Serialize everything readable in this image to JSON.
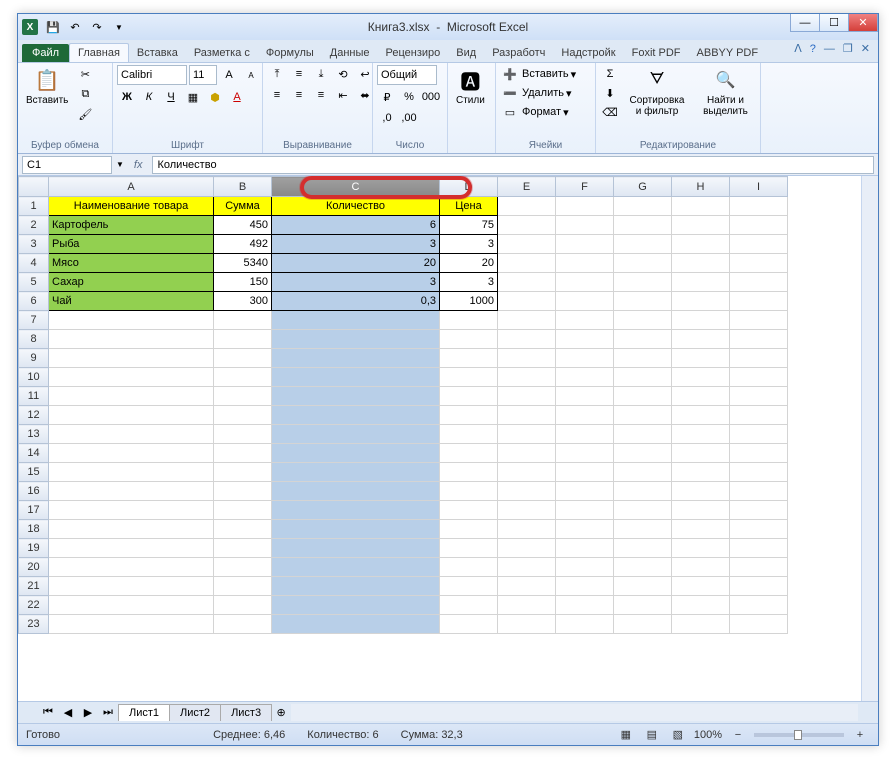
{
  "window": {
    "title_doc": "Книга3.xlsx",
    "title_app": "Microsoft Excel"
  },
  "ribbon": {
    "file": "Файл",
    "tabs": [
      "Главная",
      "Вставка",
      "Разметка с",
      "Формулы",
      "Данные",
      "Рецензиро",
      "Вид",
      "Разработч",
      "Надстройк",
      "Foxit PDF",
      "ABBYY PDF"
    ],
    "groups": {
      "clipboard": {
        "label": "Буфер обмена",
        "paste": "Вставить"
      },
      "font": {
        "label": "Шрифт",
        "name": "Calibri",
        "size": "11"
      },
      "align": {
        "label": "Выравнивание"
      },
      "number": {
        "label": "Число",
        "format": "Общий"
      },
      "styles": {
        "label": "",
        "btn": "Стили"
      },
      "cells": {
        "label": "Ячейки",
        "insert": "Вставить",
        "delete": "Удалить",
        "format": "Формат"
      },
      "editing": {
        "label": "Редактирование",
        "sort": "Сортировка и фильтр",
        "find": "Найти и выделить"
      }
    }
  },
  "formula": {
    "namebox": "C1",
    "value": "Количество"
  },
  "columns": [
    "A",
    "B",
    "C",
    "D",
    "E",
    "F",
    "G",
    "H",
    "I"
  ],
  "sheet_data": {
    "headers": {
      "A": "Наименование товара",
      "B": "Сумма",
      "C": "Количество",
      "D": "Цена"
    },
    "rows": [
      {
        "A": "Картофель",
        "B": "450",
        "C": "6",
        "D": "75"
      },
      {
        "A": "Рыба",
        "B": "492",
        "C": "3",
        "D": "3"
      },
      {
        "A": "Мясо",
        "B": "5340",
        "C": "20",
        "D": "20"
      },
      {
        "A": "Сахар",
        "B": "150",
        "C": "3",
        "D": "3"
      },
      {
        "A": "Чай",
        "B": "300",
        "C": "0,3",
        "D": "1000"
      }
    ]
  },
  "sheets": [
    "Лист1",
    "Лист2",
    "Лист3"
  ],
  "status": {
    "ready": "Готово",
    "avg_lbl": "Среднее:",
    "avg": "6,46",
    "cnt_lbl": "Количество:",
    "cnt": "6",
    "sum_lbl": "Сумма:",
    "sum": "32,3",
    "zoom": "100%"
  }
}
